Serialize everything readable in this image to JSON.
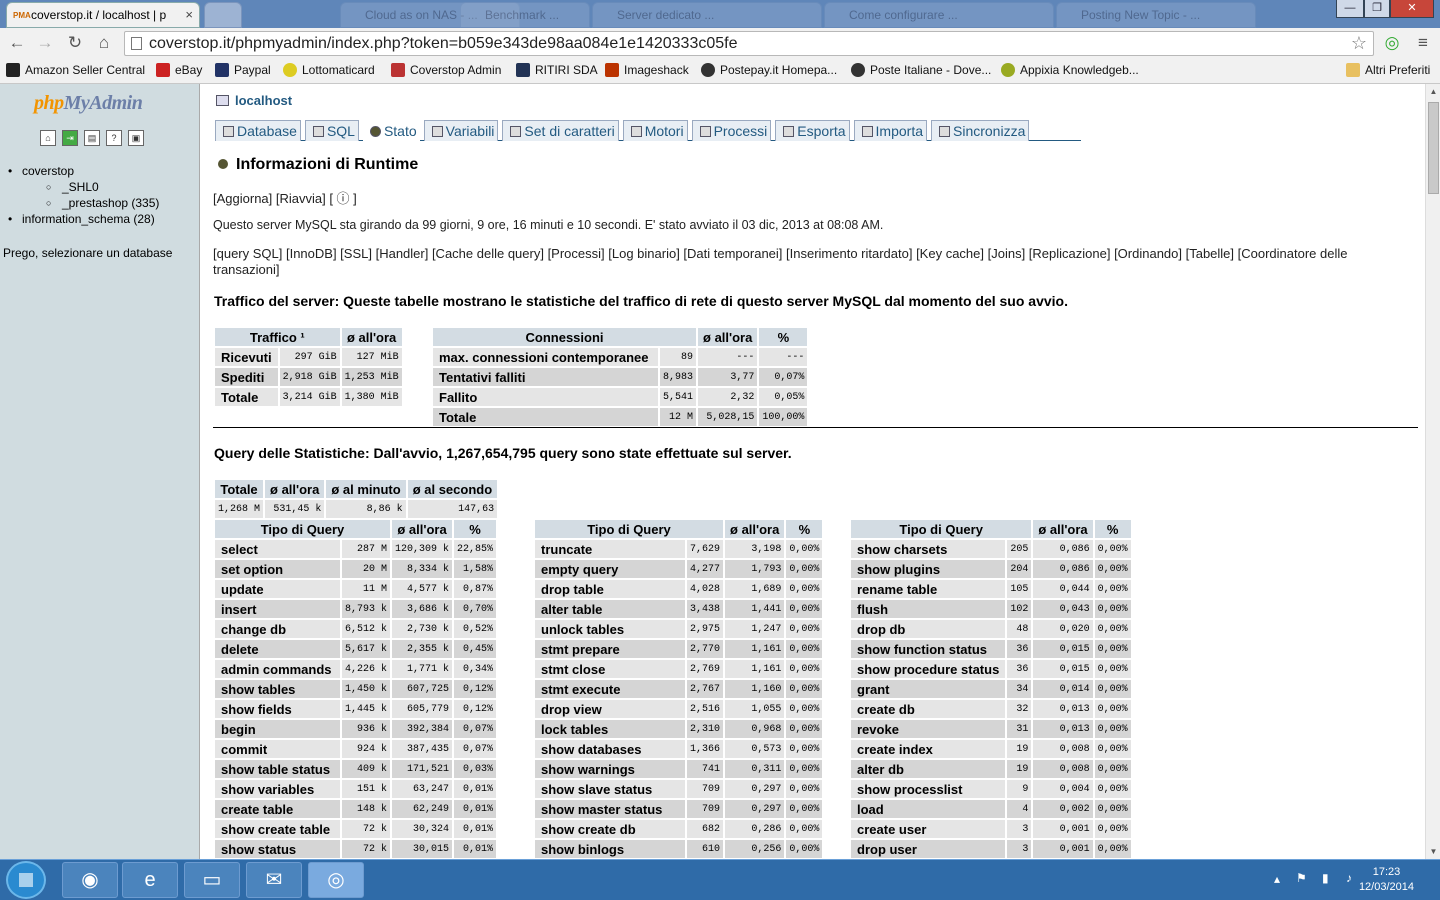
{
  "browser": {
    "tab_active": "coverstop.it / localhost | p",
    "tab_inactive": [
      "Cloud as on NAS - ...",
      "Benchmark ...",
      "Server dedicato ...",
      "Come configurare ...",
      "Posting New Topic - ..."
    ],
    "tab_close": "×",
    "url": "coverstop.it/phpmyadmin/index.php?token=b059e343de98aa084e1e1420333c05fe",
    "bookmarks": [
      "Amazon Seller Central",
      "eBay",
      "Paypal",
      "Lottomaticard",
      "Coverstop Admin",
      "RITIRI SDA",
      "Imageshack",
      "Postepay.it Homepa...",
      "Poste Italiane - Dove...",
      "Appixia Knowledgeb..."
    ],
    "other_bookmarks": "Altri Preferiti",
    "win_buttons": [
      "—",
      "❐",
      "✕"
    ]
  },
  "nav": {
    "logo_a": "php",
    "logo_b": "MyAdmin",
    "tree": [
      {
        "label": "coverstop",
        "sub": [
          "_SHL0",
          "_prestashop (335)"
        ]
      },
      {
        "label": "information_schema (28)",
        "sub": []
      }
    ],
    "hint": "Prego, selezionare un database"
  },
  "main": {
    "server": "localhost",
    "menu": [
      "Database",
      "SQL",
      "Stato",
      "Variabili",
      "Set di caratteri",
      "Motori",
      "Processi",
      "Esporta",
      "Importa",
      "Sincronizza"
    ],
    "active_menu": "Stato",
    "title": "Informazioni di Runtime",
    "actions": "[Aggiorna] [Riavvia] [ ⓘ ]",
    "uptime": "Questo server MySQL sta girando da 99 giorni, 9 ore, 16 minuti e 10 secondi. E' stato avviato il 03 dic, 2013 at 08:08 AM.",
    "links": "[query SQL] [InnoDB] [SSL] [Handler] [Cache delle query] [Processi] [Log binario] [Dati temporanei] [Inserimento ritardato] [Key cache] [Joins] [Replicazione] [Ordinando] [Tabelle] [Coordinatore delle transazioni]",
    "traffic_heading": "Traffico del server: Queste tabelle mostrano le statistiche del traffico di rete di questo server MySQL dal momento del suo avvio.",
    "traffic": {
      "headers": [
        "Traffico ¹",
        "ø all'ora"
      ],
      "rows": [
        [
          "Ricevuti",
          "297 GiB",
          "127 MiB"
        ],
        [
          "Spediti",
          "2,918 GiB",
          "1,253 MiB"
        ],
        [
          "Totale",
          "3,214 GiB",
          "1,380 MiB"
        ]
      ]
    },
    "connections": {
      "headers": [
        "Connessioni",
        "ø all'ora",
        "%"
      ],
      "rows": [
        [
          "max. connessioni contemporanee",
          "89",
          "---",
          "---"
        ],
        [
          "Tentativi falliti",
          "8,983",
          "3,77",
          "0,07%"
        ],
        [
          "Fallito",
          "5,541",
          "2,32",
          "0,05%"
        ],
        [
          "Totale",
          "12 M",
          "5,028,15",
          "100,00%"
        ]
      ]
    },
    "query_heading": "Query delle Statistiche: Dall'avvio, 1,267,654,795 query sono state effettuate sul server.",
    "qtotals": {
      "headers": [
        "Totale",
        "ø all'ora",
        "ø al minuto",
        "ø al secondo"
      ],
      "row": [
        "1,268 M",
        "531,45 k",
        "8,86 k",
        "147,63"
      ]
    },
    "qtype_headers": [
      "Tipo di Query",
      "ø all'ora",
      "%"
    ],
    "qtypes": [
      [
        [
          "select",
          "287 M",
          "120,309 k",
          "22,85%"
        ],
        [
          "set option",
          "20 M",
          "8,334 k",
          "1,58%"
        ],
        [
          "update",
          "11 M",
          "4,577 k",
          "0,87%"
        ],
        [
          "insert",
          "8,793 k",
          "3,686 k",
          "0,70%"
        ],
        [
          "change db",
          "6,512 k",
          "2,730 k",
          "0,52%"
        ],
        [
          "delete",
          "5,617 k",
          "2,355 k",
          "0,45%"
        ],
        [
          "admin commands",
          "4,226 k",
          "1,771 k",
          "0,34%"
        ],
        [
          "show tables",
          "1,450 k",
          "607,725",
          "0,12%"
        ],
        [
          "show fields",
          "1,445 k",
          "605,779",
          "0,12%"
        ],
        [
          "begin",
          "936 k",
          "392,384",
          "0,07%"
        ],
        [
          "commit",
          "924 k",
          "387,435",
          "0,07%"
        ],
        [
          "show table status",
          "409 k",
          "171,521",
          "0,03%"
        ],
        [
          "show variables",
          "151 k",
          "63,247",
          "0,01%"
        ],
        [
          "create table",
          "148 k",
          "62,249",
          "0,01%"
        ],
        [
          "show create table",
          "72 k",
          "30,324",
          "0,01%"
        ],
        [
          "show status",
          "72 k",
          "30,015",
          "0,01%"
        ]
      ],
      [
        [
          "truncate",
          "7,629",
          "3,198",
          "0,00%"
        ],
        [
          "empty query",
          "4,277",
          "1,793",
          "0,00%"
        ],
        [
          "drop table",
          "4,028",
          "1,689",
          "0,00%"
        ],
        [
          "alter table",
          "3,438",
          "1,441",
          "0,00%"
        ],
        [
          "unlock tables",
          "2,975",
          "1,247",
          "0,00%"
        ],
        [
          "stmt prepare",
          "2,770",
          "1,161",
          "0,00%"
        ],
        [
          "stmt close",
          "2,769",
          "1,161",
          "0,00%"
        ],
        [
          "stmt execute",
          "2,767",
          "1,160",
          "0,00%"
        ],
        [
          "drop view",
          "2,516",
          "1,055",
          "0,00%"
        ],
        [
          "lock tables",
          "2,310",
          "0,968",
          "0,00%"
        ],
        [
          "show databases",
          "1,366",
          "0,573",
          "0,00%"
        ],
        [
          "show warnings",
          "741",
          "0,311",
          "0,00%"
        ],
        [
          "show slave status",
          "709",
          "0,297",
          "0,00%"
        ],
        [
          "show master status",
          "709",
          "0,297",
          "0,00%"
        ],
        [
          "show create db",
          "682",
          "0,286",
          "0,00%"
        ],
        [
          "show binlogs",
          "610",
          "0,256",
          "0,00%"
        ]
      ],
      [
        [
          "show charsets",
          "205",
          "0,086",
          "0,00%"
        ],
        [
          "show plugins",
          "204",
          "0,086",
          "0,00%"
        ],
        [
          "rename table",
          "105",
          "0,044",
          "0,00%"
        ],
        [
          "flush",
          "102",
          "0,043",
          "0,00%"
        ],
        [
          "drop db",
          "48",
          "0,020",
          "0,00%"
        ],
        [
          "show function status",
          "36",
          "0,015",
          "0,00%"
        ],
        [
          "show procedure status",
          "36",
          "0,015",
          "0,00%"
        ],
        [
          "grant",
          "34",
          "0,014",
          "0,00%"
        ],
        [
          "create db",
          "32",
          "0,013",
          "0,00%"
        ],
        [
          "revoke",
          "31",
          "0,013",
          "0,00%"
        ],
        [
          "create index",
          "19",
          "0,008",
          "0,00%"
        ],
        [
          "alter db",
          "19",
          "0,008",
          "0,00%"
        ],
        [
          "show processlist",
          "9",
          "0,004",
          "0,00%"
        ],
        [
          "load",
          "4",
          "0,002",
          "0,00%"
        ],
        [
          "create user",
          "3",
          "0,001",
          "0,00%"
        ],
        [
          "drop user",
          "3",
          "0,001",
          "0,00%"
        ]
      ]
    ]
  },
  "taskbar": {
    "time": "17:23",
    "date": "12/03/2014"
  }
}
